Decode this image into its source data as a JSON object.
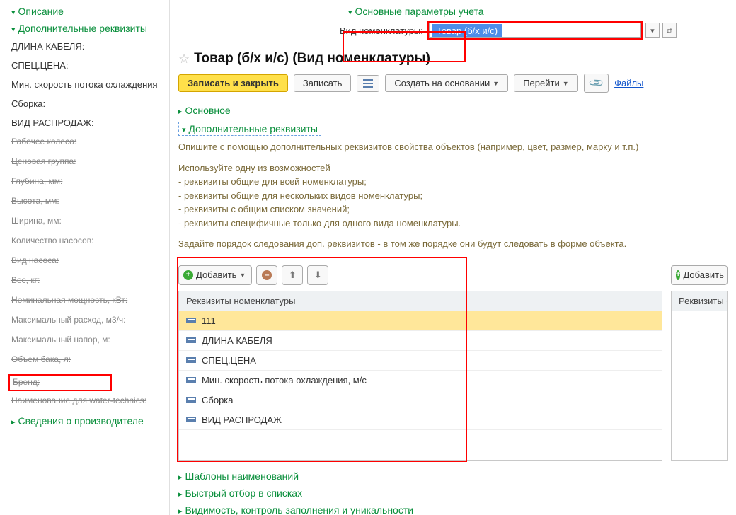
{
  "left": {
    "sec_desc": "Описание",
    "sec_extra": "Дополнительные реквизиты",
    "sec_manuf": "Сведения о производителе",
    "fields": {
      "f1": "ДЛИНА КАБЕЛЯ:",
      "f2": "СПЕЦ.ЦЕНА:",
      "f3": "Мин. скорость потока охлаждения",
      "f4": "Сборка:",
      "f5": "ВИД РАСПРОДАЖ:"
    },
    "strikes": {
      "s1": "Рабочее колесо:",
      "s2": "Ценовая группа:",
      "s3": "Глубина, мм:",
      "s4": "Высота, мм:",
      "s5": "Ширина, мм:",
      "s6": "Количество насосов:",
      "s7": "Вид насоса:",
      "s8": "Вес, кг:",
      "s9": "Номинальная мощность, кВт:",
      "s10": "Максимальный расход, м3/ч:",
      "s11": "Максимальный напор, м:",
      "s12": "Объем бака, л:",
      "s13": "Бренд:",
      "s14": "Наименование для water-technics:"
    }
  },
  "top": {
    "sec_params": "Основные параметры учета",
    "nom_label": "Вид номенклатуры:",
    "nom_value": "Товар (б/х и/с)"
  },
  "page": {
    "title": "Товар (б/х и/с) (Вид номенклатуры)"
  },
  "toolbar": {
    "write_close": "Записать и закрыть",
    "write": "Записать",
    "create_on": "Создать на основании",
    "goto": "Перейти",
    "files": "Файлы"
  },
  "body": {
    "sec_main": "Основное",
    "sec_extra": "Дополнительные реквизиты",
    "hint1": "Опишите с помощью дополнительных реквизитов свойства объектов (например, цвет, размер, марку и т.п.)",
    "hint2": "Используйте одну из возможностей",
    "opt1": "- реквизиты общие для всей номенклатуры;",
    "opt2": "- реквизиты общие для нескольких видов номенклатуры;",
    "opt3": "- реквизиты с общим списком значений;",
    "opt4": "- реквизиты специфичные только для одного вида номенклатуры.",
    "order_hint": "Задайте порядок следования доп. реквизитов - в том же порядке они будут следовать в форме объекта.",
    "add": "Добавить",
    "grid_header": "Реквизиты номенклатуры",
    "rows": {
      "r1": "111",
      "r2": "ДЛИНА КАБЕЛЯ",
      "r3": "СПЕЦ.ЦЕНА",
      "r4": "Мин. скорость потока охлаждения, м/с",
      "r5": "Сборка",
      "r6": "ВИД РАСПРОДАЖ"
    },
    "right_add": "Добавить",
    "right_header": "Реквизиты с",
    "sec_templates": "Шаблоны наименований",
    "sec_filter": "Быстрый отбор в списках",
    "sec_visibility": "Видимость, контроль заполнения и уникальности"
  }
}
